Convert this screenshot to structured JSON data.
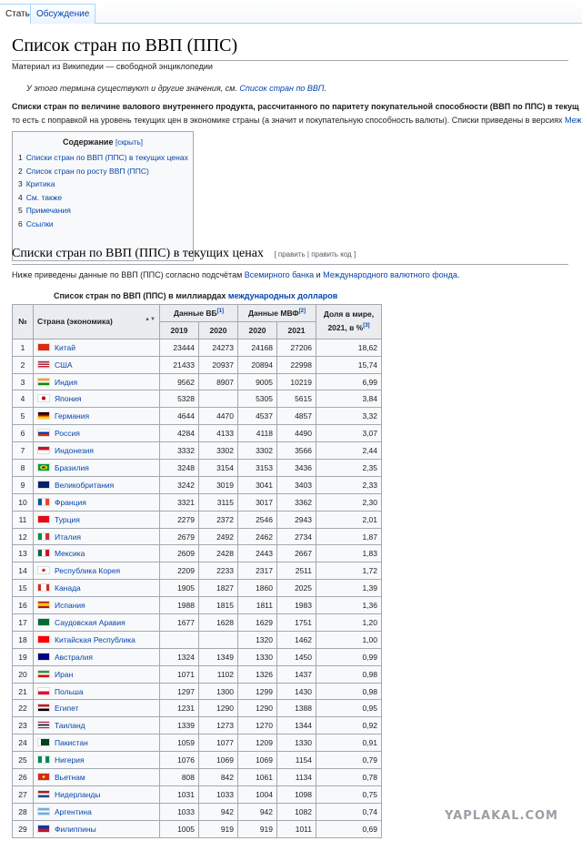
{
  "tabs": [
    {
      "label": "Статья"
    },
    {
      "label": "Обсуждение"
    }
  ],
  "page": {
    "title": "Список стран по ВВП (ППС)",
    "subtitle": "Материал из Википедии — свободной энциклопедии",
    "hatnote_prefix": "У этого термина существуют и другие значения, см. ",
    "hatnote_link": "Список стран по ВВП",
    "hatnote_suffix": ".",
    "intro_line1_bold": "Списки стран по величине валового внутреннего продукта, рассчитанного по паритету покупательной способности (ВВП по ППС) в текущ",
    "intro_line2": "то есть с поправкой на уровень текущих цен в экономике страны (а значит и покупательную способность валюты). Списки приведены в версиях ",
    "intro_line2_link": "Меж"
  },
  "toc": {
    "title": "Содержание",
    "toggle": "[скрыть]",
    "items": [
      {
        "num": "1",
        "label": "Списки стран по ВВП (ППС) в текущих ценах"
      },
      {
        "num": "2",
        "label": "Список стран по росту ВВП (ППС)"
      },
      {
        "num": "3",
        "label": "Критика"
      },
      {
        "num": "4",
        "label": "См. также"
      },
      {
        "num": "5",
        "label": "Примечания"
      },
      {
        "num": "6",
        "label": "Ссылки"
      }
    ]
  },
  "section": {
    "heading": "Списки стран по ВВП (ППС) в текущих ценах",
    "edit": "[ править | править код ]",
    "intro_prefix": "Ниже приведены данные по ВВП (ППС) согласно подсчётам ",
    "intro_link1": "Всемирного банка",
    "intro_mid": " и ",
    "intro_link2": "Международного валютного фонда",
    "intro_suffix": "."
  },
  "table": {
    "caption_prefix": "Список стран по ВВП (ППС) в миллиардах ",
    "caption_link": "международных долларов",
    "headers": {
      "rank": "№",
      "country": "Страна (экономика)",
      "wb": "Данные ВБ",
      "wb_ref": "[1]",
      "imf": "Данные МВФ",
      "imf_ref": "[2]",
      "share": "Доля в мире, 2021, в %",
      "share_ref": "[3]",
      "y2019": "2019",
      "y2020a": "2020",
      "y2020b": "2020",
      "y2021": "2021"
    },
    "rows": [
      {
        "rank": "1",
        "country": "Китай",
        "flag": "cn",
        "wb2019": "23444",
        "wb2020": "24273",
        "imf2020": "24168",
        "imf2021": "27206",
        "share": "18,62"
      },
      {
        "rank": "2",
        "country": "США",
        "flag": "us",
        "wb2019": "21433",
        "wb2020": "20937",
        "imf2020": "20894",
        "imf2021": "22998",
        "share": "15,74"
      },
      {
        "rank": "3",
        "country": "Индия",
        "flag": "in",
        "wb2019": "9562",
        "wb2020": "8907",
        "imf2020": "9005",
        "imf2021": "10219",
        "share": "6,99"
      },
      {
        "rank": "4",
        "country": "Япония",
        "flag": "jp",
        "wb2019": "5328",
        "wb2020": "",
        "imf2020": "5305",
        "imf2021": "5615",
        "share": "3,84"
      },
      {
        "rank": "5",
        "country": "Германия",
        "flag": "de",
        "wb2019": "4644",
        "wb2020": "4470",
        "imf2020": "4537",
        "imf2021": "4857",
        "share": "3,32"
      },
      {
        "rank": "6",
        "country": "Россия",
        "flag": "ru",
        "wb2019": "4284",
        "wb2020": "4133",
        "imf2020": "4118",
        "imf2021": "4490",
        "share": "3,07"
      },
      {
        "rank": "7",
        "country": "Индонезия",
        "flag": "id",
        "wb2019": "3332",
        "wb2020": "3302",
        "imf2020": "3302",
        "imf2021": "3566",
        "share": "2,44"
      },
      {
        "rank": "8",
        "country": "Бразилия",
        "flag": "br",
        "wb2019": "3248",
        "wb2020": "3154",
        "imf2020": "3153",
        "imf2021": "3436",
        "share": "2,35"
      },
      {
        "rank": "9",
        "country": "Великобритания",
        "flag": "gb",
        "wb2019": "3242",
        "wb2020": "3019",
        "imf2020": "3041",
        "imf2021": "3403",
        "share": "2,33"
      },
      {
        "rank": "10",
        "country": "Франция",
        "flag": "fr",
        "wb2019": "3321",
        "wb2020": "3115",
        "imf2020": "3017",
        "imf2021": "3362",
        "share": "2,30"
      },
      {
        "rank": "11",
        "country": "Турция",
        "flag": "tr",
        "wb2019": "2279",
        "wb2020": "2372",
        "imf2020": "2546",
        "imf2021": "2943",
        "share": "2,01"
      },
      {
        "rank": "12",
        "country": "Италия",
        "flag": "it",
        "wb2019": "2679",
        "wb2020": "2492",
        "imf2020": "2462",
        "imf2021": "2734",
        "share": "1,87"
      },
      {
        "rank": "13",
        "country": "Мексика",
        "flag": "mx",
        "wb2019": "2609",
        "wb2020": "2428",
        "imf2020": "2443",
        "imf2021": "2667",
        "share": "1,83"
      },
      {
        "rank": "14",
        "country": "Республика Корея",
        "flag": "kr",
        "wb2019": "2209",
        "wb2020": "2233",
        "imf2020": "2317",
        "imf2021": "2511",
        "share": "1,72"
      },
      {
        "rank": "15",
        "country": "Канада",
        "flag": "ca",
        "wb2019": "1905",
        "wb2020": "1827",
        "imf2020": "1860",
        "imf2021": "2025",
        "share": "1,39"
      },
      {
        "rank": "16",
        "country": "Испания",
        "flag": "es",
        "wb2019": "1988",
        "wb2020": "1815",
        "imf2020": "1811",
        "imf2021": "1983",
        "share": "1,36"
      },
      {
        "rank": "17",
        "country": "Саудовская Аравия",
        "flag": "sa",
        "wb2019": "1677",
        "wb2020": "1628",
        "imf2020": "1629",
        "imf2021": "1751",
        "share": "1,20"
      },
      {
        "rank": "18",
        "country": "Китайская Республика",
        "flag": "tw",
        "wb2019": "",
        "wb2020": "",
        "imf2020": "1320",
        "imf2021": "1462",
        "share": "1,00"
      },
      {
        "rank": "19",
        "country": "Австралия",
        "flag": "au",
        "wb2019": "1324",
        "wb2020": "1349",
        "imf2020": "1330",
        "imf2021": "1450",
        "share": "0,99"
      },
      {
        "rank": "20",
        "country": "Иран",
        "flag": "ir",
        "wb2019": "1071",
        "wb2020": "1102",
        "imf2020": "1326",
        "imf2021": "1437",
        "share": "0,98"
      },
      {
        "rank": "21",
        "country": "Польша",
        "flag": "pl",
        "wb2019": "1297",
        "wb2020": "1300",
        "imf2020": "1299",
        "imf2021": "1430",
        "share": "0,98"
      },
      {
        "rank": "22",
        "country": "Египет",
        "flag": "eg",
        "wb2019": "1231",
        "wb2020": "1290",
        "imf2020": "1290",
        "imf2021": "1388",
        "share": "0,95"
      },
      {
        "rank": "23",
        "country": "Таиланд",
        "flag": "th",
        "wb2019": "1339",
        "wb2020": "1273",
        "imf2020": "1270",
        "imf2021": "1344",
        "share": "0,92"
      },
      {
        "rank": "24",
        "country": "Пакистан",
        "flag": "pk",
        "wb2019": "1059",
        "wb2020": "1077",
        "imf2020": "1209",
        "imf2021": "1330",
        "share": "0,91"
      },
      {
        "rank": "25",
        "country": "Нигерия",
        "flag": "ng",
        "wb2019": "1076",
        "wb2020": "1069",
        "imf2020": "1069",
        "imf2021": "1154",
        "share": "0,79"
      },
      {
        "rank": "26",
        "country": "Вьетнам",
        "flag": "vn",
        "wb2019": "808",
        "wb2020": "842",
        "imf2020": "1061",
        "imf2021": "1134",
        "share": "0,78"
      },
      {
        "rank": "27",
        "country": "Нидерланды",
        "flag": "nl",
        "wb2019": "1031",
        "wb2020": "1033",
        "imf2020": "1004",
        "imf2021": "1098",
        "share": "0,75"
      },
      {
        "rank": "28",
        "country": "Аргентина",
        "flag": "ar",
        "wb2019": "1033",
        "wb2020": "942",
        "imf2020": "942",
        "imf2021": "1082",
        "share": "0,74"
      },
      {
        "rank": "29",
        "country": "Филиппины",
        "flag": "ph",
        "wb2019": "1005",
        "wb2020": "919",
        "imf2020": "919",
        "imf2021": "1011",
        "share": "0,69"
      }
    ]
  },
  "watermark": "YAPLAKAL.COM",
  "flags": {
    "cn": "linear-gradient(#de2910,#de2910)",
    "us": "repeating-linear-gradient(#b22234 0 1.3px,#fff 1.3px 2.6px)",
    "in": "linear-gradient(#ff9933 33%,#fff 33% 66%,#138808 66%)",
    "jp": "radial-gradient(circle,#bc002d 30%,#fff 32%)",
    "de": "linear-gradient(#000 33%,#dd0000 33% 66%,#ffce00 66%)",
    "ru": "linear-gradient(#fff 33%,#0039a6 33% 66%,#d52b1e 66%)",
    "id": "linear-gradient(#ce1126 50%,#fff 50%)",
    "br": "radial-gradient(ellipse,#002776 22%,#fedf00 24% 45%,#009b3a 47%)",
    "gb": "linear-gradient(#012169,#012169)",
    "fr": "linear-gradient(90deg,#0055a4 33%,#fff 33% 66%,#ef4135 66%)",
    "tr": "linear-gradient(#e30a17,#e30a17)",
    "it": "linear-gradient(90deg,#009246 33%,#fff 33% 66%,#ce2b37 66%)",
    "mx": "linear-gradient(90deg,#006847 33%,#fff 33% 66%,#ce1126 66%)",
    "kr": "radial-gradient(circle,#cd2e3a 25%,#fff 27%)",
    "ca": "linear-gradient(90deg,#d52b1e 25%,#fff 25% 75%,#d52b1e 75%)",
    "es": "linear-gradient(#aa151b 25%,#f1bf00 25% 75%,#aa151b 75%)",
    "sa": "linear-gradient(#006c35,#006c35)",
    "tw": "linear-gradient(#fe0000,#fe0000)",
    "au": "linear-gradient(#00008b,#00008b)",
    "ir": "linear-gradient(#239f40 33%,#fff 33% 66%,#da0000 66%)",
    "pl": "linear-gradient(#fff 50%,#dc143c 50%)",
    "eg": "linear-gradient(#ce1126 33%,#fff 33% 66%,#000 66%)",
    "th": "linear-gradient(#a51931 17%,#fff 17% 33%,#2d2a4a 33% 67%,#fff 67% 83%,#a51931 83%)",
    "pk": "linear-gradient(90deg,#fff 25%,#01411c 25%)",
    "ng": "linear-gradient(90deg,#008751 33%,#fff 33% 66%,#008751 66%)",
    "vn": "radial-gradient(circle,#ffff00 18%,#da251d 20%)",
    "nl": "linear-gradient(#ae1c28 33%,#fff 33% 66%,#21468b 66%)",
    "ar": "linear-gradient(#74acdf 33%,#fff 33% 66%,#74acdf 66%)",
    "ph": "linear-gradient(#0038a8 50%,#ce1126 50%)"
  }
}
